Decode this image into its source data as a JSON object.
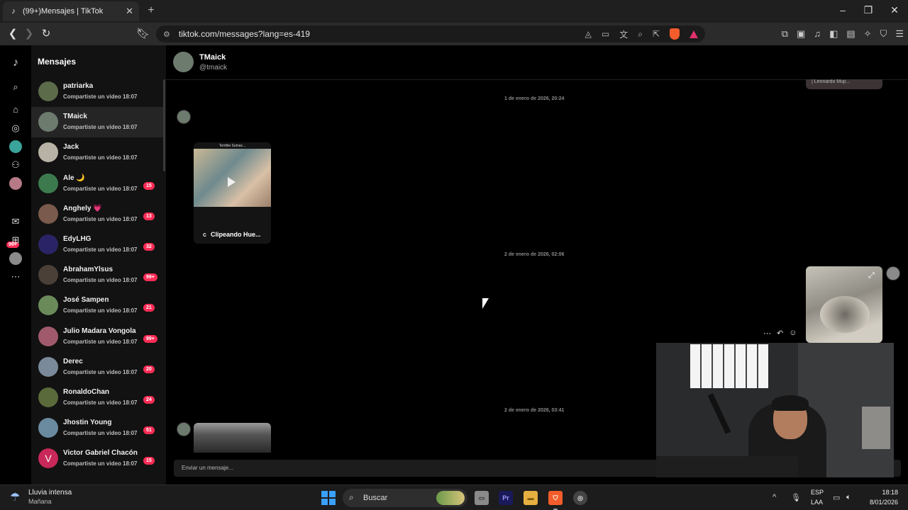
{
  "browser": {
    "tab_title": "(99+)Mensajes | TikTok",
    "url": "tiktok.com/messages?lang=es-419",
    "shield_count": "4"
  },
  "rail": {
    "badge_notifications": "99+",
    "badge_messages": "3"
  },
  "sidebar": {
    "title": "Mensajes",
    "conversations": [
      {
        "name": "patriarka",
        "preview": "Compartiste un video 18:07",
        "badge": "",
        "color": "#5c6b4a"
      },
      {
        "name": "TMaick",
        "preview": "Compartiste un video 18:07",
        "badge": "",
        "color": "#6d7a6e"
      },
      {
        "name": "Jack",
        "preview": "Compartiste un video 18:07",
        "badge": "",
        "color": "#b8b1a6"
      },
      {
        "name": "Ale 🌙",
        "preview": "Compartiste un video 18:07",
        "badge": "15",
        "color": "#3c7a4e"
      },
      {
        "name": "Anghely 💗",
        "preview": "Compartiste un video 18:07",
        "badge": "13",
        "color": "#7a5a4c"
      },
      {
        "name": "EdyLHG",
        "preview": "Compartiste un video 18:07",
        "badge": "32",
        "color": "#2a2466"
      },
      {
        "name": "AbrahamYlsus",
        "preview": "Compartiste un video 18:07",
        "badge": "99+",
        "color": "#4a4038"
      },
      {
        "name": "José Sampen",
        "preview": "Compartiste un video 18:07",
        "badge": "21",
        "color": "#6a8a5a"
      },
      {
        "name": "Julio Madara Vongola",
        "preview": "Compartiste un video 18:07",
        "badge": "99+",
        "color": "#a05a6a"
      },
      {
        "name": "Derec",
        "preview": "Compartiste un video 18:07",
        "badge": "20",
        "color": "#7a8a9a"
      },
      {
        "name": "RonaldoChan",
        "preview": "Compartiste un video 18:07",
        "badge": "24",
        "color": "#5a6a3a"
      },
      {
        "name": "Jhostin Young",
        "preview": "Compartiste un video 18:07",
        "badge": "51",
        "color": "#6a8aa0"
      },
      {
        "name": "Victor Gabriel Chacón",
        "preview": "Compartiste un video 18:07",
        "badge": "15",
        "color": "#c8285a",
        "initial": "V"
      }
    ]
  },
  "chat": {
    "name": "TMaick",
    "handle": "@tmaick",
    "top_card_caption": "| Leonardo Muji...",
    "date1": "1 de enero de 2026, 20:24",
    "date2": "2 de enero de 2026, 02:06",
    "date3": "2 de enero de 2026, 03:41",
    "video_title": "Terrible Sumac...",
    "video_caption_initial": "c",
    "video_caption": "Clipeando Hue...",
    "composer_placeholder": "Enviar un mensaje..."
  },
  "taskbar": {
    "weather_title": "Lluvia intensa",
    "weather_sub": "Mañana",
    "search_label": "Buscar",
    "lang_line1": "ESP",
    "lang_line2": "LAA",
    "time": "18:18",
    "date": "8/01/2026"
  }
}
